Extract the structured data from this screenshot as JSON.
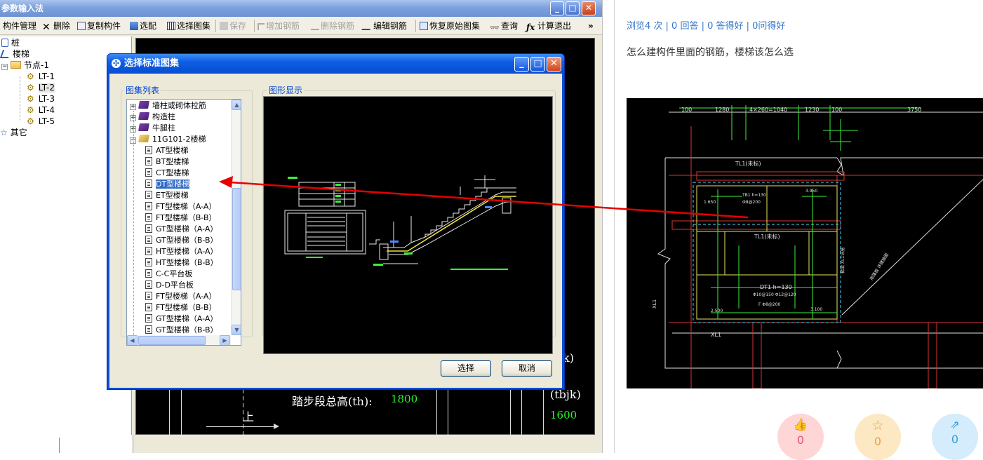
{
  "app": {
    "title": "参数输入法",
    "window_buttons": [
      "_",
      "□",
      "✕"
    ],
    "toolbar": [
      {
        "label": "构件管理",
        "icon": "component-icon",
        "enabled": true
      },
      {
        "label": "删除",
        "icon": "delete-icon",
        "enabled": true
      },
      {
        "label": "复制构件",
        "icon": "copy-icon",
        "enabled": true
      },
      {
        "label": "选配",
        "icon": "select-fit-icon",
        "enabled": true
      },
      {
        "label": "选择图集",
        "icon": "atlas-icon",
        "enabled": true
      },
      {
        "label": "保存",
        "icon": "save-icon",
        "enabled": false
      },
      {
        "label": "增加钢筋",
        "icon": "add-rebar-icon",
        "enabled": false
      },
      {
        "label": "删除钢筋",
        "icon": "delete-rebar-icon",
        "enabled": false
      },
      {
        "label": "编辑钢筋",
        "icon": "edit-rebar-icon",
        "enabled": true
      },
      {
        "label": "恢复原始图集",
        "icon": "restore-icon",
        "enabled": true
      },
      {
        "label": "查询",
        "icon": "binoculars-icon",
        "enabled": true
      },
      {
        "label": "计算退出",
        "icon": "fx-icon",
        "enabled": true
      }
    ],
    "toolbar_overflow": "»",
    "tree": {
      "pile": "桩",
      "stairs": "楼梯",
      "node": "节点-1",
      "items": [
        "LT-1",
        "LT-2",
        "LT-3",
        "LT-4",
        "LT-5"
      ],
      "other": "其它"
    },
    "canvas": {
      "step_height_label": "踏步段总高(th):",
      "step_height_value": "1800",
      "right_label_1": "k)",
      "right_label_2": "(tbjk)",
      "right_value": "1600",
      "up_label": "上"
    }
  },
  "dialog": {
    "title": "选择标准图集",
    "list_group_label": "图集列表",
    "preview_group_label": "图形显示",
    "list_items": [
      {
        "label": "墙柱或砌体拉筋",
        "kind": "book",
        "expander": "+"
      },
      {
        "label": "构造柱",
        "kind": "book",
        "expander": "+"
      },
      {
        "label": "牛腿柱",
        "kind": "book",
        "expander": "+"
      },
      {
        "label": "11G101-2楼梯",
        "kind": "openbook",
        "expander": "−"
      },
      {
        "label": "AT型楼梯",
        "kind": "page"
      },
      {
        "label": "BT型楼梯",
        "kind": "page"
      },
      {
        "label": "CT型楼梯",
        "kind": "page"
      },
      {
        "label": "DT型楼梯",
        "kind": "page",
        "selected": true
      },
      {
        "label": "ET型楼梯",
        "kind": "page"
      },
      {
        "label": "FT型楼梯（A-A）",
        "kind": "page"
      },
      {
        "label": "FT型楼梯（B-B）",
        "kind": "page"
      },
      {
        "label": "GT型楼梯（A-A）",
        "kind": "page"
      },
      {
        "label": "GT型楼梯（B-B）",
        "kind": "page"
      },
      {
        "label": "HT型楼梯（A-A）",
        "kind": "page"
      },
      {
        "label": "HT型楼梯（B-B）",
        "kind": "page"
      },
      {
        "label": "C-C平台板",
        "kind": "page"
      },
      {
        "label": "D-D平台板",
        "kind": "page"
      },
      {
        "label": "FT型楼梯（A-A）",
        "kind": "page"
      },
      {
        "label": "FT型楼梯（B-B）",
        "kind": "page"
      },
      {
        "label": "GT型楼梯（A-A）",
        "kind": "page"
      },
      {
        "label": "GT型楼梯（B-B）",
        "kind": "page"
      }
    ],
    "ok_label": "选择",
    "cancel_label": "取消"
  },
  "qa": {
    "stats": "浏览4 次 | 0 回答 | 0 答得好 | 0问得好",
    "question": "怎么建构件里面的钢筋，楼梯该怎么选",
    "drawing_labels": {
      "dims": [
        "100",
        "1280",
        "4×260=1040",
        "1230",
        "100",
        "3750"
      ],
      "tl_top": "TL1(未标)",
      "tl_mid": "TL1(未标)",
      "dt": "DT1 h=130",
      "xl": "XL1"
    },
    "actions": [
      {
        "icon": "thumbs-up-icon",
        "count": "0",
        "color": "#ffd6d6",
        "fg": "#e8546a"
      },
      {
        "icon": "star-icon",
        "count": "0",
        "color": "#fde8c4",
        "fg": "#e6a23c"
      },
      {
        "icon": "share-icon",
        "count": "0",
        "color": "#d4ecfb",
        "fg": "#3a9bd9"
      }
    ]
  },
  "colors": {
    "xp_blue": "#0a4fd6",
    "selection": "#316ac5",
    "arrow": "#e60000",
    "link": "#3377cc"
  }
}
